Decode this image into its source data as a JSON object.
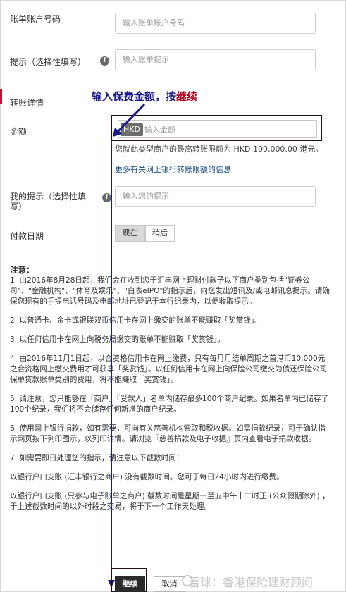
{
  "form": {
    "bill_account_label": "账单账户号码",
    "bill_account_placeholder": "输入账单账户号码",
    "hint_label": "提示（选择性填写）",
    "hint_placeholder": "输入账单提示",
    "section_title": "转账详情",
    "amount_label": "金额",
    "currency": "HKD",
    "amount_placeholder": "输入金额",
    "limit_note": "您就此类型商户的最高转账限额为 HKD 100,000.00 港元。",
    "limit_link": "更多有关网上银行转账限额的信息",
    "my_hint_label": "我的提示（选择性填写）",
    "my_hint_placeholder": "输入您的提示",
    "pay_date_label": "付款日期",
    "pay_now": "现在",
    "pay_later": "稍后"
  },
  "annotation": {
    "text": "输入保费金额，按",
    "emphasis": "继续"
  },
  "notes": {
    "title": "注意：",
    "items": [
      "1. 由2016年8月28日起，我们会在收到您于汇丰网上理财付款予以下商户类别包括\"证券公司\"、\"金融机构\"、\"体育及娱乐\"、\"白表eIPO\"的指示后，向您发出短讯及/或电邮讯息提示。请确保您现有的手提电话号码及电邮地址已登记于本行纪录内，以便收取提示。",
      "2. 以普通卡、金卡或银联双币信用卡在网上缴交的账单不能赚取「奖赏钱」。",
      "3. 以任何信用卡在网上向税务局缴交的账单不能赚取「奖赏钱」。",
      "4. 由2016年11月1日起，以合资格信用卡在网上缴费，只有每月月结单周期之首港币10,000元之合资格网上缴交费用才可获享「奖赏钱」。以任何信用卡在网上向保险公司缴交为债还保险公司保单贷款账单类别的费用，将不能赚取「奖赏钱」。",
      "5. 请注意，您只能够在「商户」「受款人」名单内储存最多100个商户纪录。如果名单内已储存了100个纪录，我们将不会储存任何新增的商户纪录。",
      "6. 使用网上银行捐款，如有需要，可向有关慈善机构索取和税收据。如需捐款纪录，可于确认指示网页按下列印图示，以列印详情。请浏览『慈善捐款及电子收据』页内查看电子捐款收据。",
      "7. 如需要即日处理您的指示，请注意以下截数时间：",
      "以银行户口支账 (汇丰银行之商户) 没有截数时间。您可于每日24小时内进行缴费。",
      "以银行户口支账 (只参与电子账单之商户) 截数时间是星期一至五中午十二时正 (公众假期除外) ，于上述截数时间的以外时段之交易，将于下一个工作天处理。"
    ]
  },
  "buttons": {
    "continue": "继续",
    "cancel": "取消"
  },
  "watermark": {
    "text": "雪球：香港保险理财顾问"
  },
  "colors": {
    "accent_red": "#c2112b",
    "annotation_blue": "#1a1a8c",
    "annotation_red": "#b0001e",
    "highlight_border": "#2a0b18"
  }
}
